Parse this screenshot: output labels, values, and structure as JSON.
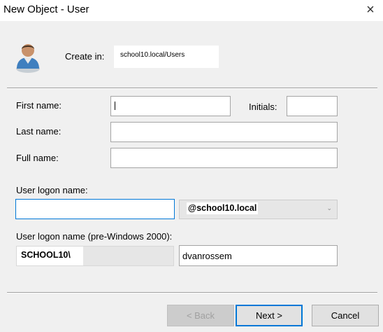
{
  "window": {
    "title": "New Object - User",
    "close_icon": "×"
  },
  "header": {
    "create_in_label": "Create in:",
    "create_in_value": "school10.local/Users",
    "icon": "user-icon"
  },
  "form": {
    "first_name_label": "First name:",
    "first_name_value": "",
    "initials_label": "Initials:",
    "initials_value": "",
    "last_name_label": "Last name:",
    "last_name_value": "",
    "full_name_label": "Full name:",
    "full_name_value": "",
    "logon_name_label": "User logon name:",
    "logon_name_value": "",
    "upn_suffix_selected": "@school10.local",
    "pre2000_label": "User logon name (pre-Windows 2000):",
    "pre2000_domain": "SCHOOL10\\",
    "pre2000_value": "dvanrossem"
  },
  "buttons": {
    "back": "< Back",
    "next": "Next >",
    "cancel": "Cancel"
  },
  "colors": {
    "accent": "#0078d7",
    "dialog_bg": "#f0f0f0"
  }
}
